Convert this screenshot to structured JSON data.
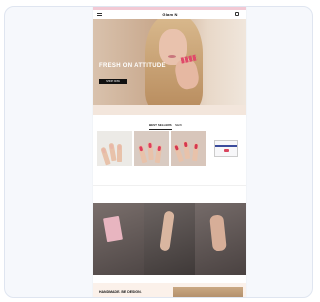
{
  "promo_bar": {
    "text": ""
  },
  "header": {
    "logo": "Glam N"
  },
  "hero": {
    "headline": "FRESH ON ATTITUDE",
    "cta": "SHOP NOW"
  },
  "strip": {
    "text": ""
  },
  "tabs": [
    {
      "label": "BEST SELLERS"
    },
    {
      "label": "NEW"
    }
  ],
  "products": [
    {
      "name": "",
      "price": "",
      "nail_color": "#e9b7a8"
    },
    {
      "name": "",
      "price": "",
      "nail_color": "#e03b5c"
    },
    {
      "name": "",
      "price": "",
      "nail_color": "#d6364f"
    },
    {
      "name": "",
      "price": "",
      "nail_color": "#3b4b9c"
    }
  ],
  "categories": [
    {
      "label": ""
    },
    {
      "label": ""
    },
    {
      "label": ""
    }
  ],
  "bottom": {
    "title": "HANDMADE. BE DESIGN."
  }
}
